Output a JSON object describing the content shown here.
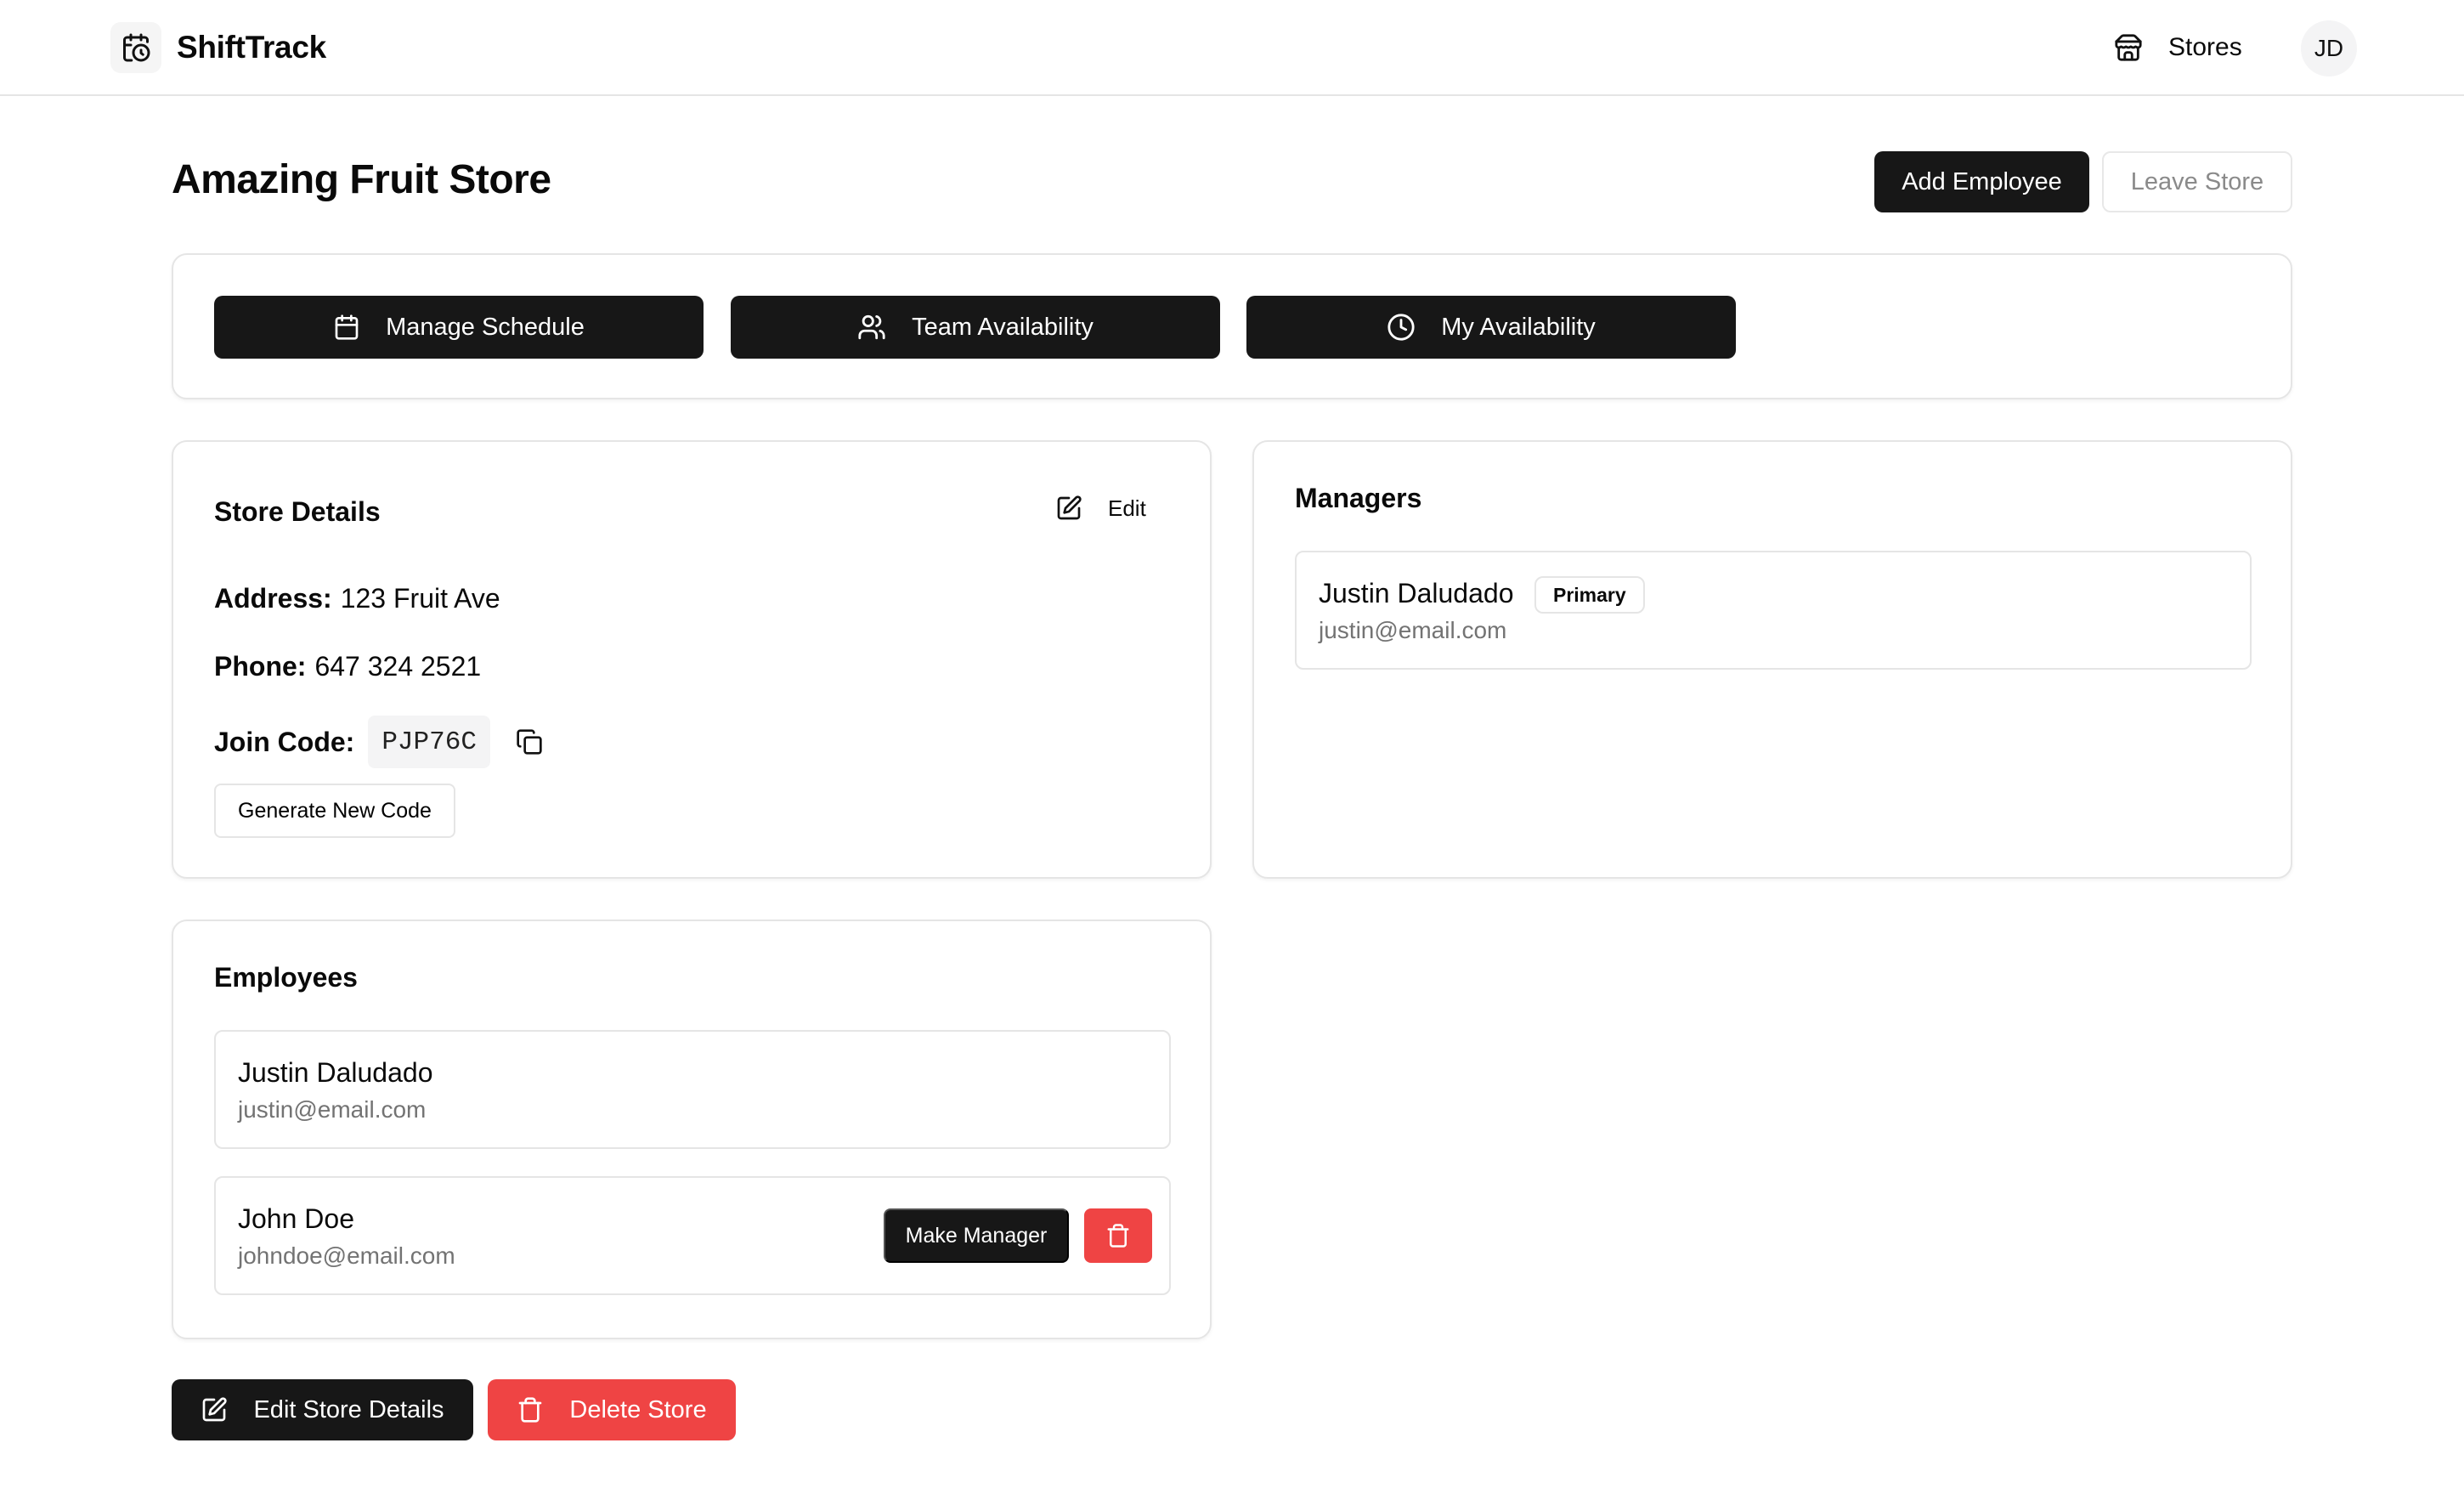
{
  "app": {
    "name": "ShiftTrack",
    "nav_stores_label": "Stores",
    "user_initials": "JD",
    "icons": {
      "brand": "calendar-clock-icon",
      "stores": "store-icon"
    }
  },
  "page": {
    "title": "Amazing Fruit Store",
    "add_employee_label": "Add Employee",
    "leave_store_label": "Leave Store"
  },
  "quick_actions": [
    {
      "label": "Manage Schedule",
      "icon": "calendar-icon"
    },
    {
      "label": "Team Availability",
      "icon": "users-icon"
    },
    {
      "label": "My Availability",
      "icon": "clock-icon"
    }
  ],
  "store_details": {
    "title": "Store Details",
    "edit_label": "Edit",
    "address_label": "Address:",
    "address_value": "123 Fruit Ave",
    "phone_label": "Phone:",
    "phone_value": "647 324 2521",
    "join_code_label": "Join Code:",
    "join_code_value": "PJP76C",
    "generate_code_label": "Generate New Code"
  },
  "managers": {
    "title": "Managers",
    "items": [
      {
        "name": "Justin Daludado",
        "badge": "Primary",
        "email": "justin@email.com"
      }
    ]
  },
  "employees": {
    "title": "Employees",
    "items": [
      {
        "name": "Justin Daludado",
        "email": "justin@email.com"
      },
      {
        "name": "John Doe",
        "email": "johndoe@email.com",
        "make_manager_label": "Make Manager"
      }
    ]
  },
  "footer_actions": {
    "edit_store_label": "Edit Store Details",
    "delete_store_label": "Delete Store"
  },
  "colors": {
    "primary": "#171717",
    "danger": "#ef4444",
    "border": "#e5e5e5",
    "muted_text": "#737373"
  }
}
